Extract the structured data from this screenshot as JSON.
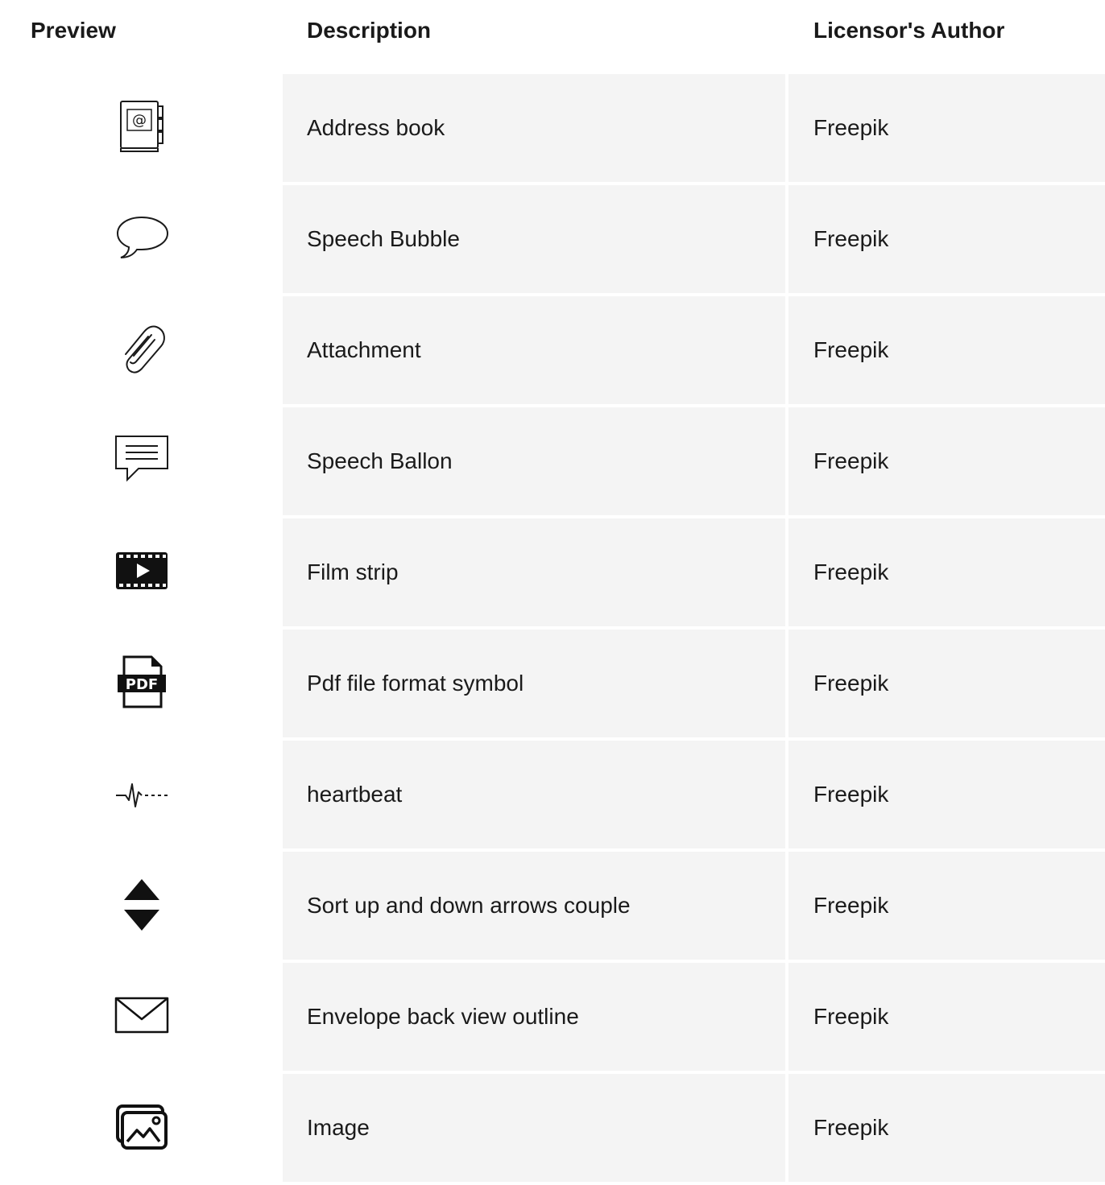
{
  "table": {
    "headers": {
      "preview": "Preview",
      "description": "Description",
      "author": "Licensor's Author"
    },
    "rows": [
      {
        "icon": "address-book-icon",
        "description": "Address book",
        "author": "Freepik"
      },
      {
        "icon": "speech-bubble-icon",
        "description": "Speech Bubble",
        "author": "Freepik"
      },
      {
        "icon": "attachment-icon",
        "description": "Attachment",
        "author": "Freepik"
      },
      {
        "icon": "speech-balloon-icon",
        "description": "Speech Ballon",
        "author": "Freepik"
      },
      {
        "icon": "film-strip-icon",
        "description": "Film strip",
        "author": "Freepik"
      },
      {
        "icon": "pdf-file-icon",
        "description": "Pdf file format symbol",
        "author": "Freepik"
      },
      {
        "icon": "heartbeat-icon",
        "description": "heartbeat",
        "author": "Freepik"
      },
      {
        "icon": "sort-arrows-icon",
        "description": "Sort up and down arrows couple",
        "author": "Freepik"
      },
      {
        "icon": "envelope-icon",
        "description": "Envelope back view outline",
        "author": "Freepik"
      },
      {
        "icon": "image-icon",
        "description": "Image",
        "author": "Freepik"
      }
    ]
  }
}
